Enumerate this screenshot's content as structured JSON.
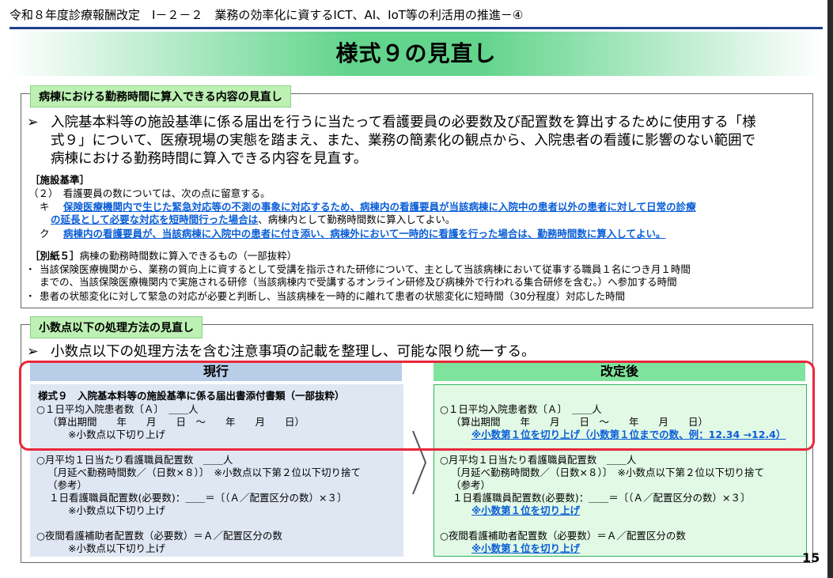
{
  "header": {
    "text": "令和８年度診療報酬改定　Ⅰ－２－２　業務の効率化に資するICT、AI、IoT等の利活用の推進－④"
  },
  "title": "様式９の見直し",
  "section1": {
    "tag": "病棟における勤務時間に算入できる内容の見直し",
    "bullet_marker": "➢",
    "intro_lines": [
      "入院基本料等の施設基準に係る届出を行うに当たって看護要員の必要数及び配置数を算出するために使用する「様",
      "式９」について、医療現場の実態を踏まえ、また、業務の簡素化の観点から、入院患者の看護に影響のない範囲で",
      "病棟における勤務時間に算入できる内容を見直す。"
    ],
    "shisetsu_label": "［施設基準］",
    "item2": "（２）　看護要員の数については、次の点に留意する。",
    "ki_marker": "キ",
    "ki_line1": "保険医療機関内で生じた緊急対応等の不測の事象に対応するため、病棟内の看護要員が当該病棟に入院中の患者以外の患者に対して日常の診療",
    "ki_line2_blue": "の延長として必要な対応を短時間行った場合は",
    "ki_line2_rest": "、病棟内として勤務時間数に算入してよい。",
    "ku_marker": "ク",
    "ku_line": "病棟内の看護要員が、当該病棟に入院中の患者に付き添い、病棟外において一時的に看護を行った場合は、勤務時間数に算入してよい。",
    "besshi_label": "［別紙５］",
    "besshi_text": "病棟の勤務時間数に算入できるもの（一部抜粋）",
    "dot_marker": "・",
    "dot1_line1": "当該保険医療機関から、業務の質向上に資するとして受講を指示された研修について、主として当該病棟において従事する職員１名につき月１時間",
    "dot1_line2": "までの、当該保険医療機関内で実施される研修（当該病棟内で受講するオンライン研修及び病棟外で行われる集合研修を含む。）へ参加する時間",
    "dot2": "患者の状態変化に対して緊急の対応が必要と判断し、当該病棟を一時的に離れて患者の状態変化に短時間（30分程度）対応した時間"
  },
  "section2": {
    "tag": "小数点以下の処理方法の見直し",
    "intro": "小数点以下の処理方法を含む注意事項の記載を整理し、可能な限り統一する。",
    "current": {
      "heading": "現行",
      "form_title": "様式９　入院基本料等の施設基準に係る届出書添付書類（一部抜粋）",
      "l1": "○１日平均入院患者数〔Ａ〕　＿＿人",
      "l2": "（算出期間　　年　　月　　日　～　　年　　月　　日）",
      "l3": "※小数点以下切り上げ",
      "l4": "○月平均１日当たり看護職員配置数　＿＿人",
      "l5": "〔月延べ勤務時間数／（日数×８）〕　※小数点以下第２位以下切り捨て",
      "l6": "（参考）",
      "l7": "１日看護職員配置数(必要数)：＿＿＝〔（Ａ／配置区分の数）×３〕",
      "l8": "※小数点以下切り上げ",
      "l9": "○夜間看護補助者配置数（必要数）＝Ａ／配置区分の数",
      "l10": "※小数点以下切り上げ"
    },
    "revised": {
      "heading": "改定後",
      "l1": "○１日平均入院患者数〔Ａ〕　＿＿人",
      "l2": "（算出期間　　年　　月　　日　～　　年　　月　　日）",
      "l3_blue": "※小数第１位を切り上げ（小数第１位までの数、例：12.34 →12.4）",
      "l4": "○月平均１日当たり看護職員配置数　＿＿人",
      "l5": "〔月延べ勤務時間数／（日数×８）〕　※小数点以下第２位以下切り捨て",
      "l6": "（参考）",
      "l7": "１日看護職員配置数(必要数)：＿＿＝〔（Ａ／配置区分の数）×３〕",
      "l8_blue": "※小数第１位を切り上げ",
      "l9": "○夜間看護補助者配置数（必要数）＝Ａ／配置区分の数",
      "l10_blue": "※小数第１位を切り上げ"
    }
  },
  "page_number": "15",
  "colors": {
    "title_green": "#62d48c",
    "highlight_red": "#e8283a",
    "link_blue": "#0b5ed7",
    "current_blue": "#b8cde8",
    "revised_green": "#7ee39c"
  }
}
